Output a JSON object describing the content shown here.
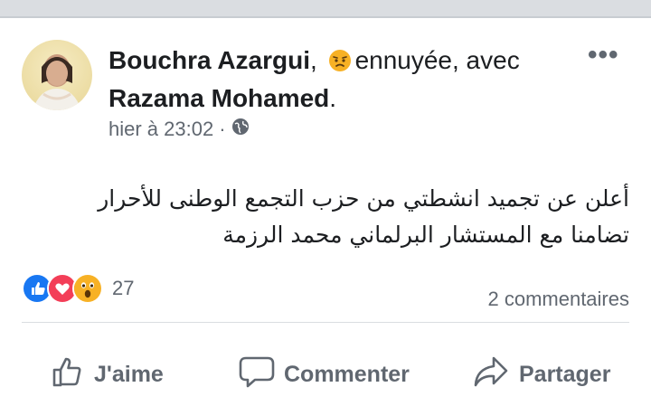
{
  "post": {
    "author": "Bouchra Azargui",
    "comma": ",",
    "feeling_emoji": "annoyed-face-icon",
    "feeling_text": "ennuyée, avec",
    "tagged": "Razama Mohamed",
    "period": ".",
    "timestamp": "hier à 23:02",
    "dot": "·",
    "privacy_icon": "globe-icon",
    "text_line1": "أعلن عن تجميد انشطتي من حزب التجمع الوطنى للأحرار",
    "text_line2": "تضامنا مع المستشار البرلماني محمد الرزمة",
    "more_icon": "•••"
  },
  "reactions": {
    "icons": [
      "like-reaction-icon",
      "love-reaction-icon",
      "wow-reaction-icon"
    ],
    "count": "27",
    "comments": "2 commentaires"
  },
  "actions": {
    "like": "J'aime",
    "comment": "Commenter",
    "share": "Partager"
  },
  "colors": {
    "like_blue": "#1877f2",
    "love_red": "#f33e58",
    "wow_yellow": "#f7b125",
    "muted_text": "#606770"
  }
}
